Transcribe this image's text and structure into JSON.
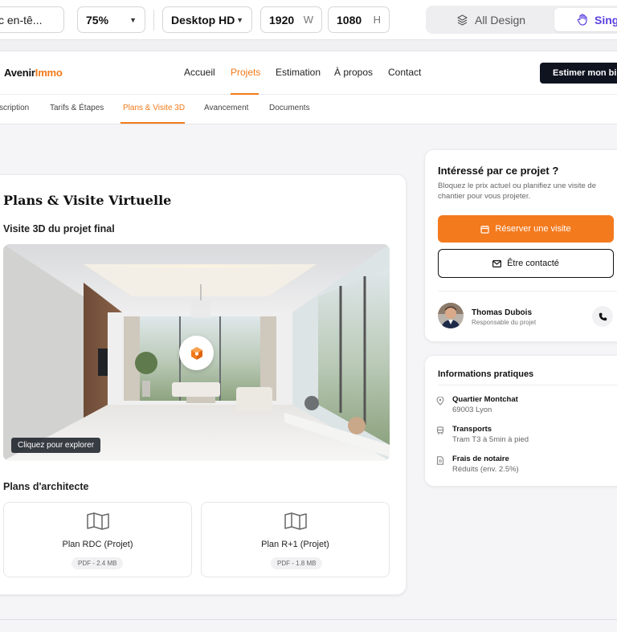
{
  "toolbar": {
    "header_field": "c en-tê...",
    "zoom": "75%",
    "device": "Desktop HD",
    "width": "1920",
    "width_unit": "W",
    "height": "1080",
    "height_unit": "H",
    "mode_all": "All Design",
    "mode_single": "Singl"
  },
  "site": {
    "logo_main": "Avenir",
    "logo_accent": "Immo",
    "nav": [
      "Accueil",
      "Projets",
      "Estimation",
      "À propos",
      "Contact"
    ],
    "active_nav": "Projets",
    "cta": "Estimer mon bien",
    "accent_color": "#f27a1a"
  },
  "tabs": {
    "items": [
      "scription",
      "Tarifs & Étapes",
      "Plans & Visite 3D",
      "Avancement",
      "Documents"
    ],
    "active": "Plans & Visite 3D"
  },
  "main": {
    "title": "Plans & Visite Virtuelle",
    "visit_heading": "Visite 3D du projet final",
    "explore_label": "Cliquez pour explorer",
    "plans_heading": "Plans d'architecte",
    "plans": [
      {
        "name": "Plan RDC (Projet)",
        "size": "PDF - 2.4 MB"
      },
      {
        "name": "Plan R+1 (Projet)",
        "size": "PDF - 1.8 MB"
      }
    ]
  },
  "sidebar": {
    "interest_title": "Intéressé par ce projet ?",
    "interest_desc": "Bloquez le prix actuel ou planifiez une visite de chantier pour vous projeter.",
    "reserve_label": "Réserver une visite",
    "contact_label": "Être contacté",
    "agent_name": "Thomas Dubois",
    "agent_role": "Responsable du projet",
    "info_title": "Informations pratiques",
    "info": [
      {
        "icon": "map-pin-icon",
        "label": "Quartier Montchat",
        "value": "69003 Lyon"
      },
      {
        "icon": "train-icon",
        "label": "Transports",
        "value": "Tram T3 à 5min à pied"
      },
      {
        "icon": "document-icon",
        "label": "Frais de notaire",
        "value": "Réduits (env. 2.5%)"
      }
    ]
  }
}
